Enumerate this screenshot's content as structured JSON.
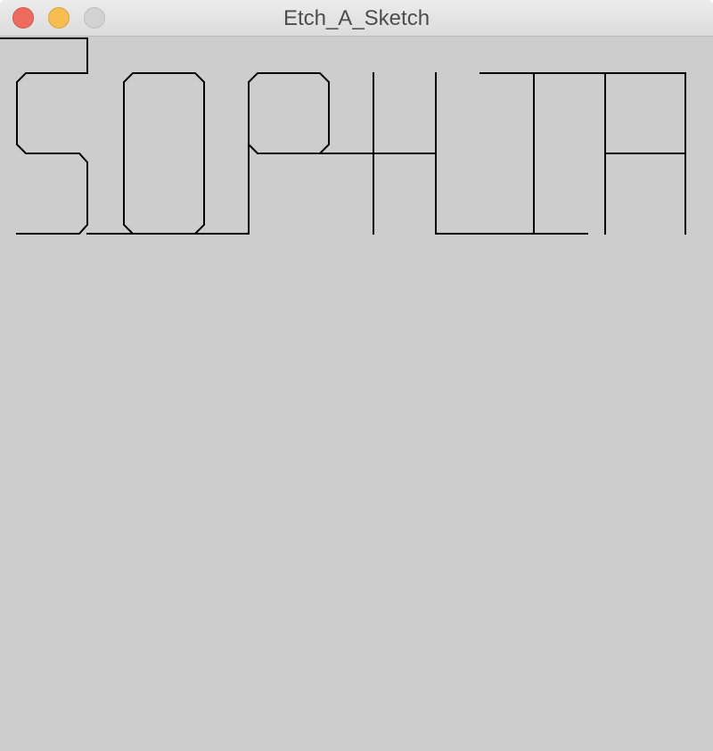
{
  "window": {
    "title": "Etch_A_Sketch"
  },
  "controls": {
    "close_icon": "close-icon",
    "minimize_icon": "minimize-icon",
    "zoom_icon": "zoom-icon",
    "close_color": "#ee6a5f",
    "minimize_color": "#f5be4f",
    "zoom_color": "#d2d2d2"
  },
  "canvas": {
    "background_color": "#cdcdcd",
    "stroke_color": "#000000"
  }
}
